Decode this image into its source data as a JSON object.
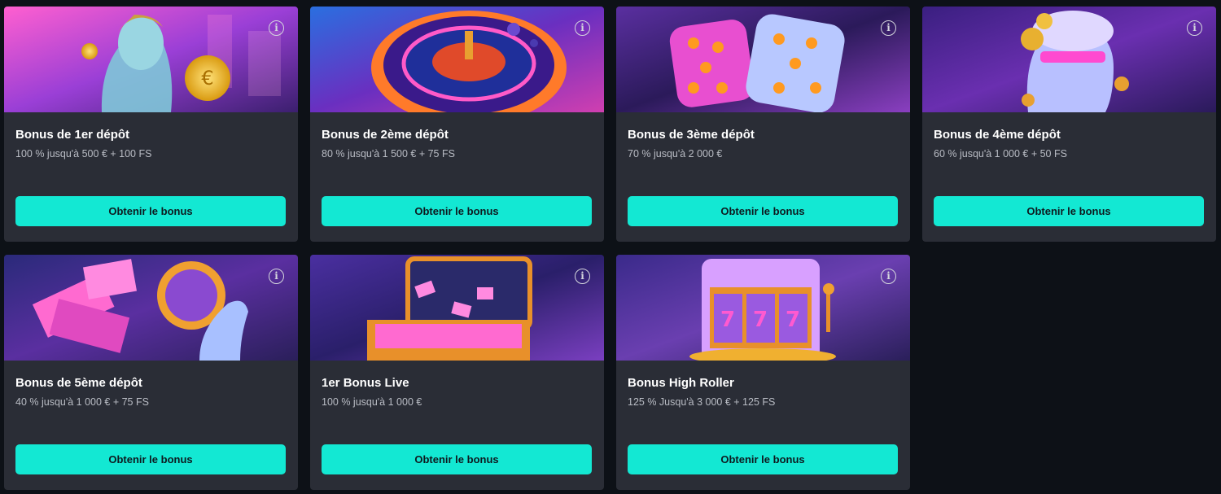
{
  "cards": [
    {
      "title": "Bonus de 1er dépôt",
      "desc": "100 % jusqu'à 500 € + 100 FS",
      "button": "Obtenir le bonus",
      "image": "goddess-with-gold-coin"
    },
    {
      "title": "Bonus de 2ème dépôt",
      "desc": "80 % jusqu'à 1 500 € + 75 FS",
      "button": "Obtenir le bonus",
      "image": "neon-roulette-wheel"
    },
    {
      "title": "Bonus de 3ème dépôt",
      "desc": "70 % jusqu'à 2 000 €",
      "button": "Obtenir le bonus",
      "image": "neon-dice"
    },
    {
      "title": "Bonus de 4ème dépôt",
      "desc": "60 % jusqu'à 1 000 € + 50 FS",
      "button": "Obtenir le bonus",
      "image": "statue-with-coins"
    },
    {
      "title": "Bonus de 5ème dépôt",
      "desc": "40 % jusqu'à 1 000 € + 75 FS",
      "button": "Obtenir le bonus",
      "image": "hand-with-coin-and-bills"
    },
    {
      "title": "1er Bonus Live",
      "desc": "100 % jusqu'à 1 000 €",
      "button": "Obtenir le bonus",
      "image": "money-briefcase"
    },
    {
      "title": "Bonus High Roller",
      "desc": "125 % Jusqu'à 3 000 € + 125 FS",
      "button": "Obtenir le bonus",
      "image": "slot-machine-777"
    }
  ],
  "info_symbol": "i",
  "colors": {
    "background": "#0d1117",
    "card": "#2a2d36",
    "button": "#13e8d3",
    "title": "#ffffff",
    "desc": "#b9bcc4"
  }
}
